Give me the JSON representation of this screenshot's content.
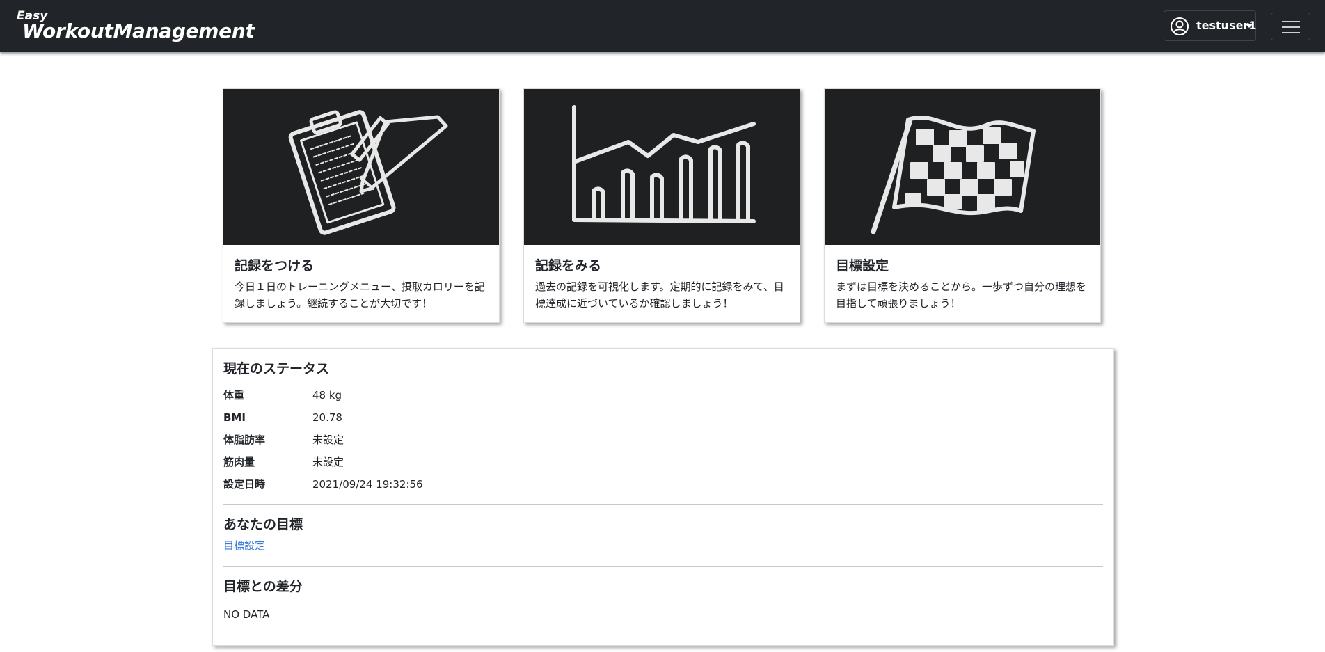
{
  "navbar": {
    "brand_small": "Easy",
    "brand_big": "WorkoutManagement",
    "user_icon": "user-circle-icon",
    "username": "testuser1",
    "menu_icon": "hamburger-menu-icon"
  },
  "cards": [
    {
      "image": "clipboard-pencil-chalk-drawing",
      "title": "記録をつける",
      "text": "今日１日のトレーニングメニュー、摂取カロリーを記録しましょう。継続することが大切です！"
    },
    {
      "image": "chart-chalk-drawing",
      "title": "記録をみる",
      "text": "過去の記録を可視化します。定期的に記録をみて、目標達成に近づいているか確認しましょう！"
    },
    {
      "image": "checkered-flag-chalk-drawing",
      "title": "目標設定",
      "text": "まずは目標を決めることから。一歩ずつ自分の理想を目指して頑張りましょう！"
    }
  ],
  "status": {
    "title": "現在のステータス",
    "rows": [
      {
        "label": "体重",
        "value": "48 kg"
      },
      {
        "label": "BMI",
        "value": "20.78"
      },
      {
        "label": "体脂肪率",
        "value": "未設定"
      },
      {
        "label": "筋肉量",
        "value": "未設定"
      },
      {
        "label": "設定日時",
        "value": "2021/09/24 19:32:56"
      }
    ]
  },
  "goal": {
    "title": "あなたの目標",
    "link": "目標設定"
  },
  "diff": {
    "title": "目標との差分",
    "text": "NO DATA"
  },
  "colors": {
    "navbar_bg": "#212529",
    "link": "#3a7bd5",
    "card_image_bg": "#1f2021"
  }
}
